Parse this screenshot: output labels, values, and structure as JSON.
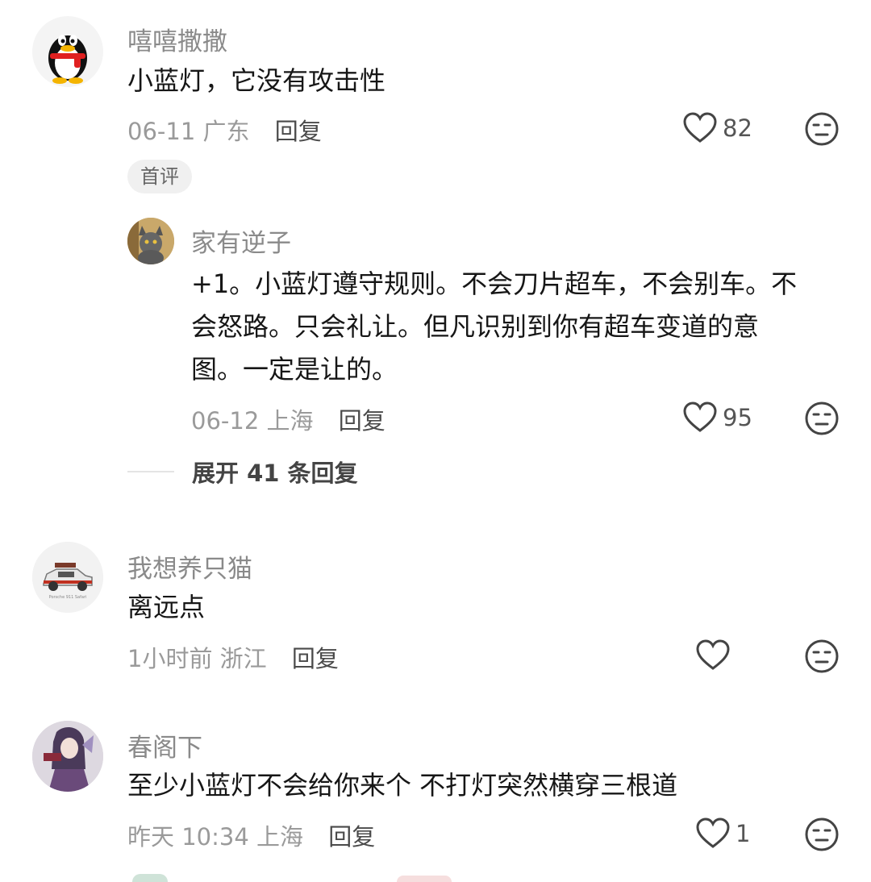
{
  "comments": [
    {
      "username": "嘻嘻撒撒",
      "content": "小蓝灯，它没有攻击性",
      "date": "06-11",
      "location": "广东",
      "reply_label": "回复",
      "likes": "82",
      "badge": "首评",
      "avatar_icon": "qq-penguin-avatar",
      "replies": [
        {
          "username": "家有逆子",
          "content_lines": [
            "+1。小蓝灯遵守规则。不会刀片超车，不会别车。不",
            "会怒路。只会礼让。但凡识别到你有超车变道的意",
            "图。一定是让的。"
          ],
          "date": "06-12",
          "location": "上海",
          "reply_label": "回复",
          "likes": "95",
          "avatar_icon": "cat-avatar"
        }
      ],
      "expand_label": "展开 41 条回复"
    },
    {
      "username": "我想养只猫",
      "content": "离远点",
      "date": "1小时前",
      "location": "浙江",
      "reply_label": "回复",
      "likes": "",
      "avatar_icon": "car-avatar",
      "avatar_caption": "Porsche 911 Safari"
    },
    {
      "username": "春阁下",
      "content": "至少小蓝灯不会给你来个 不打灯突然横穿三根道",
      "date": "昨天 10:34",
      "location": "上海",
      "reply_label": "回复",
      "likes": "1",
      "avatar_icon": "anime-character-avatar"
    }
  ],
  "colors": {
    "username": "#8a8a8a",
    "content": "#161616",
    "meta": "#9a9a9a",
    "badge_bg": "#f0f0f0"
  }
}
